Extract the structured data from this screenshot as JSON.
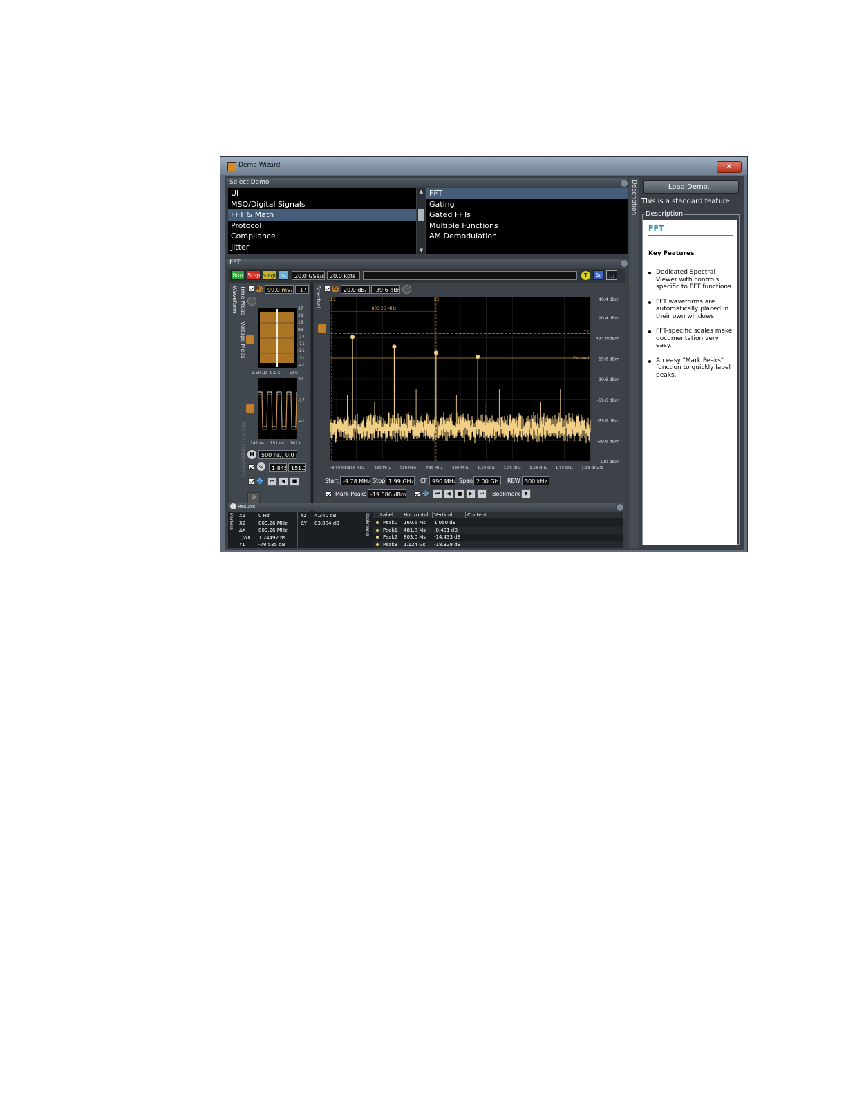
{
  "window": {
    "title": "Demo Wizard",
    "close_label": "x"
  },
  "select_demo": {
    "header": "Select Demo",
    "categories": [
      {
        "label": "UI",
        "selected": false
      },
      {
        "label": "MSO/Digital Signals",
        "selected": false
      },
      {
        "label": "FFT & Math",
        "selected": true
      },
      {
        "label": "Protocol",
        "selected": false
      },
      {
        "label": "Compliance",
        "selected": false
      },
      {
        "label": "Jitter",
        "selected": false
      }
    ],
    "demos": [
      {
        "label": "FFT",
        "selected": true
      },
      {
        "label": "Gating",
        "selected": false
      },
      {
        "label": "Gated FFTs",
        "selected": false
      },
      {
        "label": "Multiple Functions",
        "selected": false
      },
      {
        "label": "AM Demodulation",
        "selected": false
      }
    ]
  },
  "description_panel": {
    "tab_label": "Description",
    "load_button": "Load Demo...",
    "standard_note": "This is a standard feature.",
    "group_label": "Description",
    "title": "FFT",
    "title_color": "#1a8fb0",
    "key_features_heading": "Key Features",
    "features": [
      "Dedicated Spectral Viewer with controls specific to FFT functions.",
      "FFT waveforms are automatically placed in their own windows.",
      "FFT-specific scales make documentation very easy.",
      "An easy \"Mark Peaks\" function to quickly label peaks."
    ]
  },
  "fft_pane": {
    "header": "FFT",
    "toolbar": {
      "run": "Run",
      "stop": "Stop",
      "single": "Single",
      "sample_rate": "20.0 GSa/s",
      "points": "20.0 kpts",
      "trigger_icon_label": "T"
    },
    "waveform": {
      "tab_waveform": "Waveform",
      "tab_time_meas": "Time Meas",
      "tab_voltage_meas": "Voltage Meas",
      "tab_measurements": "Measurements",
      "ch_scale": "99.0 mV/",
      "ch_offset": "-17",
      "ch_badge": "M1",
      "upper_x_labels": [
        "-2.50 µs",
        "0.0 s",
        "250"
      ],
      "upper_y_labels": [
        "37",
        "29",
        "18",
        "83",
        "-17",
        "-11",
        "-21",
        "-31",
        "-41"
      ],
      "lower_x_labels": [
        "142 ns",
        "151 ns",
        "161 r"
      ],
      "lower_y_labels": [
        "37",
        "-17",
        "-41"
      ],
      "timebase": "500 ns/, 0.0 s",
      "cursor_values": [
        "1.845",
        "151.2"
      ]
    },
    "spectral": {
      "tab_label": "Spectral",
      "fn_badge": "f1",
      "vscale": "20.0 dB/",
      "vref": "-39.6 dBm",
      "x1_label": "X1",
      "x2_label": "X2",
      "y2_label": "Y2",
      "delta_label": "803.26 MHz",
      "pk_label": "PkLevel",
      "y_ticks": [
        "40.4 dBm",
        "20.4 dBm",
        "434 mdBm",
        "-19.6 dBm",
        "-39.6 dBm",
        "-59.6 dBm",
        "-79.6 dBm",
        "-99.6 dBm",
        "-120 dBm"
      ],
      "x_ticks": [
        "-9.99 MHz",
        "190 MHz",
        "390 MHz",
        "590 MHz",
        "790 MHz",
        "990 MHz",
        "1.19 GHz",
        "1.39 GHz",
        "1.59 GHz",
        "1.79 GHz",
        "1.99 GHz",
        "f1"
      ],
      "start_label": "Start",
      "start_value": "-9.78 MHz",
      "stop_label": "Stop",
      "stop_value": "1.99 GHz",
      "cf_label": "CF",
      "cf_value": "990 MHz",
      "span_label": "Span",
      "span_value": "2.00 GHz",
      "rbw_label": "RBW",
      "rbw_value": "300 kHz",
      "mark_peaks_label": "Mark Peaks",
      "mark_peaks_value": "-19.586 dBm",
      "bookmark_label": "Bookmark",
      "trace_color": "#f2cf86",
      "marker_color": "#e0a040"
    },
    "chart_data": {
      "type": "line",
      "xlabel": "",
      "ylabel": "",
      "xlim": [
        -9.99,
        1990
      ],
      "ylim": [
        -120,
        40.4
      ],
      "noise_floor_dBm": -85,
      "peaks": [
        {
          "label": "Peak0",
          "freq_MHz": 160.6,
          "level_dBm": 1.05
        },
        {
          "label": "Peak1",
          "freq_MHz": 481.8,
          "level_dBm": -8.4
        },
        {
          "label": "Peak2",
          "freq_MHz": 803.0,
          "level_dBm": -14.43
        },
        {
          "label": "Peak3",
          "freq_MHz": 1124,
          "level_dBm": -18.33
        }
      ],
      "minor_spikes_MHz": [
        40,
        120,
        330,
        650,
        960,
        1180,
        1290,
        1450,
        1610,
        1760
      ]
    }
  },
  "results": {
    "header": "Results",
    "markers_tab": "Markers",
    "bookmarks_tab": "Bookmarks",
    "markers": [
      {
        "name": "X1",
        "value": "0 Hz"
      },
      {
        "name": "X2",
        "value": "803.26 MHz"
      },
      {
        "name": "ΔX",
        "value": "803.26 MHz"
      },
      {
        "name": "1/ΔX",
        "value": "1.24492 ns"
      },
      {
        "name": "Y1",
        "value": "-79.535 dB"
      }
    ],
    "markers_right": [
      {
        "name": "Y2",
        "value": "4.340 dB"
      },
      {
        "name": "ΔY",
        "value": "83.884 dB"
      }
    ],
    "bookmark_columns": [
      "Label",
      "Horizontal",
      "Vertical",
      "Content"
    ],
    "bookmarks": [
      {
        "label": "Peak0",
        "horizontal": "160.6 Ms",
        "vertical": "1.050 dB"
      },
      {
        "label": "Peak1",
        "horizontal": "481.8 Ms",
        "vertical": "-8.401 dB"
      },
      {
        "label": "Peak2",
        "horizontal": "803.0 Ms",
        "vertical": "-14.433 dB"
      },
      {
        "label": "Peak3",
        "horizontal": "1.124 Gs",
        "vertical": "-18.328 dB"
      }
    ]
  }
}
